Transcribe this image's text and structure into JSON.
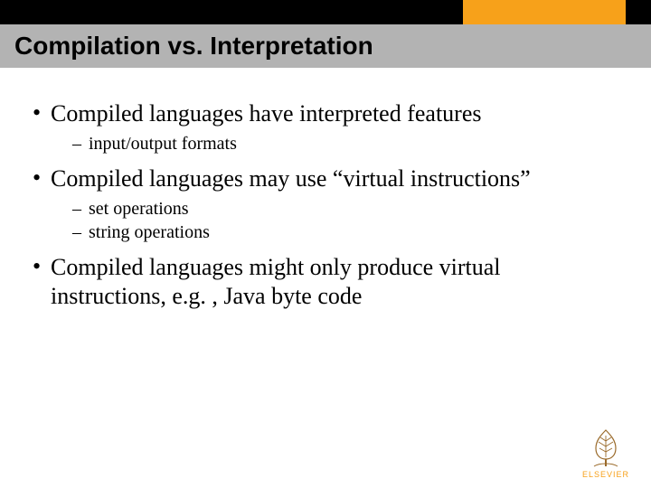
{
  "header": {
    "title": "Compilation vs. Interpretation"
  },
  "bullets": [
    {
      "text": "Compiled languages have interpreted  features",
      "sub": [
        "input/output formats"
      ]
    },
    {
      "text": "Compiled languages may use “virtual instructions”",
      "sub": [
        "set operations",
        "string operations"
      ]
    },
    {
      "text": "Compiled languages might only produce virtual instructions, e.g. , Java byte code",
      "sub": []
    }
  ],
  "footer": {
    "brand": "ELSEVIER"
  }
}
